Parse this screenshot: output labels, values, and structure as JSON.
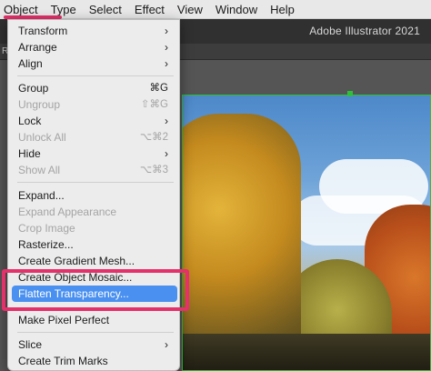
{
  "menubar": {
    "items": [
      "Object",
      "Type",
      "Select",
      "Effect",
      "View",
      "Window",
      "Help"
    ]
  },
  "app": {
    "title": "Adobe Illustrator 2021",
    "tab_fragment": "R"
  },
  "object_menu": {
    "items": [
      {
        "label": "Transform",
        "submenu": true
      },
      {
        "label": "Arrange",
        "submenu": true
      },
      {
        "label": "Align",
        "submenu": true
      },
      {
        "label": "Group",
        "shortcut": "⌘G"
      },
      {
        "label": "Ungroup",
        "shortcut": "⇧⌘G",
        "disabled": true
      },
      {
        "label": "Lock",
        "submenu": true
      },
      {
        "label": "Unlock All",
        "shortcut": "⌥⌘2",
        "disabled": true
      },
      {
        "label": "Hide",
        "submenu": true
      },
      {
        "label": "Show All",
        "shortcut": "⌥⌘3",
        "disabled": true
      },
      {
        "label": "Expand..."
      },
      {
        "label": "Expand Appearance",
        "disabled": true
      },
      {
        "label": "Crop Image",
        "disabled": true
      },
      {
        "label": "Rasterize..."
      },
      {
        "label": "Create Gradient Mesh..."
      },
      {
        "label": "Create Object Mosaic..."
      },
      {
        "label": "Flatten Transparency...",
        "highlighted": true
      },
      {
        "label": "Make Pixel Perfect"
      },
      {
        "label": "Slice",
        "submenu": true
      },
      {
        "label": "Create Trim Marks"
      }
    ],
    "submenu_arrow": "›"
  },
  "colors": {
    "highlight": "#4a90f0",
    "annotation": "#e4316b",
    "selection": "#2fbf3a"
  }
}
